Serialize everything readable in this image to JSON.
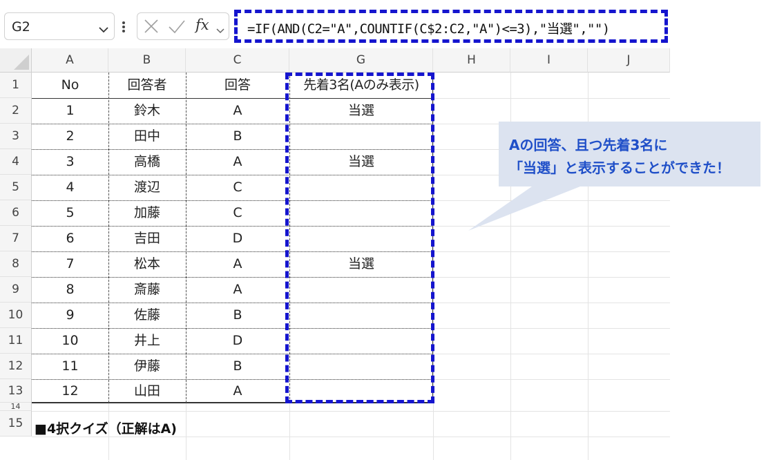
{
  "formula_bar": {
    "name_box": "G2",
    "fx_label": "fx",
    "formula": "=IF(AND(C2=\"A\",COUNTIF(C$2:C2,\"A\")<=3),\"当選\",\"\")"
  },
  "columns": [
    "A",
    "B",
    "C",
    "G",
    "H",
    "I",
    "J"
  ],
  "row_numbers": [
    "1",
    "2",
    "3",
    "4",
    "5",
    "6",
    "7",
    "8",
    "9",
    "10",
    "11",
    "12",
    "13",
    "14",
    "15"
  ],
  "table": {
    "headers": [
      "No",
      "回答者",
      "回答",
      "先着3名(Aのみ表示)"
    ],
    "rows": [
      [
        "1",
        "鈴木",
        "A",
        "当選"
      ],
      [
        "2",
        "田中",
        "B",
        ""
      ],
      [
        "3",
        "高橋",
        "A",
        "当選"
      ],
      [
        "4",
        "渡辺",
        "C",
        ""
      ],
      [
        "5",
        "加藤",
        "C",
        ""
      ],
      [
        "6",
        "吉田",
        "D",
        ""
      ],
      [
        "7",
        "松本",
        "A",
        "当選"
      ],
      [
        "8",
        "斎藤",
        "A",
        ""
      ],
      [
        "9",
        "佐藤",
        "B",
        ""
      ],
      [
        "10",
        "井上",
        "D",
        ""
      ],
      [
        "11",
        "伊藤",
        "B",
        ""
      ],
      [
        "12",
        "山田",
        "A",
        ""
      ]
    ]
  },
  "sheet_title": "■4択クイズ（正解はA)",
  "callout": {
    "line1": "Aの回答、且つ先着3名に",
    "line2": "「当選」と表示することができた！"
  },
  "colors": {
    "highlight_border": "#1515ce",
    "callout_fill": "#dce3f0",
    "callout_text": "#1f4fc8"
  },
  "icons": [
    "chevron-down-icon",
    "more-vertical-icon",
    "cancel-icon",
    "enter-icon",
    "fx-icon"
  ]
}
